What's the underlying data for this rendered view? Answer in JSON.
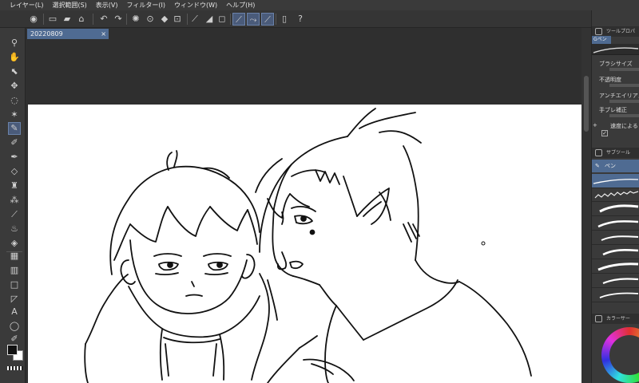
{
  "menu": [
    "レイヤー(L)",
    "選択範囲(S)",
    "表示(V)",
    "フィルター(I)",
    "ウィンドウ(W)",
    "ヘルプ(H)"
  ],
  "document": {
    "tab_title": "20220809",
    "close_icon": "×"
  },
  "tool_property": {
    "title": "ツールプロパ",
    "tab_label": "Gペン",
    "brush_size_label": "ブラシサイズ",
    "opacity_label": "不透明度",
    "antialias_label": "アンチエイリアス",
    "stabilizer_label": "手ブレ補正",
    "speed_label": "速度による"
  },
  "sub_tool": {
    "title": "サブツール",
    "selected_item": "ペン"
  },
  "color_panel": {
    "title": "カラーサー"
  },
  "colors": {
    "accent": "#4f6b92",
    "foreground": "#111111",
    "background": "#ffffff"
  }
}
